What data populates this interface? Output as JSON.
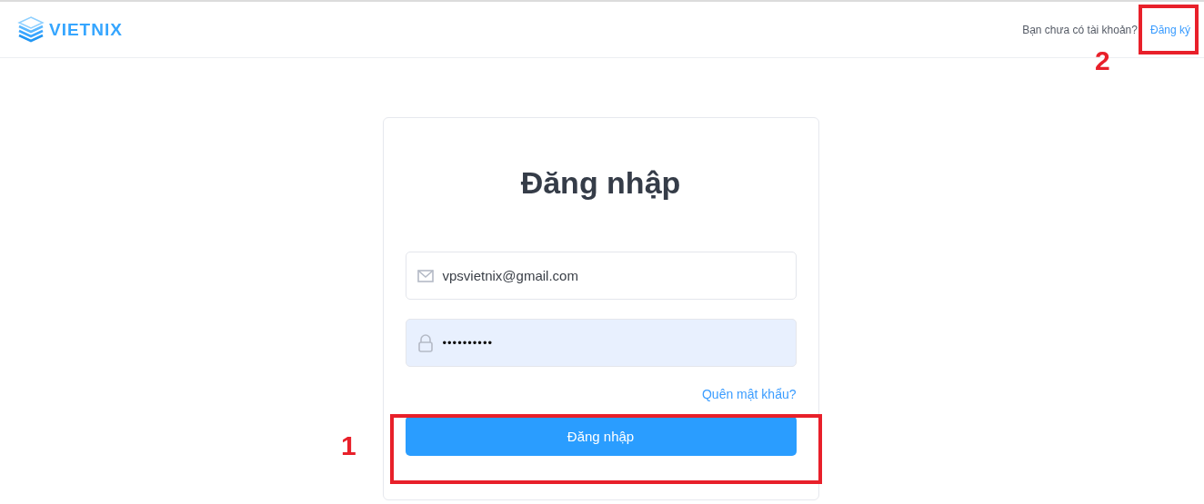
{
  "header": {
    "logo": "VIETNIX",
    "signup_prompt": "Bạn chưa có tài khoản?",
    "signup_link": "Đăng ký"
  },
  "login_card": {
    "title": "Đăng nhập",
    "fields": [
      {
        "kind": "email",
        "value": "vpsvietnix@gmail.com",
        "autofilled": false
      },
      {
        "kind": "password",
        "value": "••••••••••",
        "autofilled": true
      }
    ],
    "forgot_link": "Quên mật khẩu?",
    "submit_button": "Đăng nhập"
  },
  "annotations": [
    {
      "label": "1",
      "kind": "submit"
    },
    {
      "label": "2",
      "kind": "signup"
    }
  ]
}
